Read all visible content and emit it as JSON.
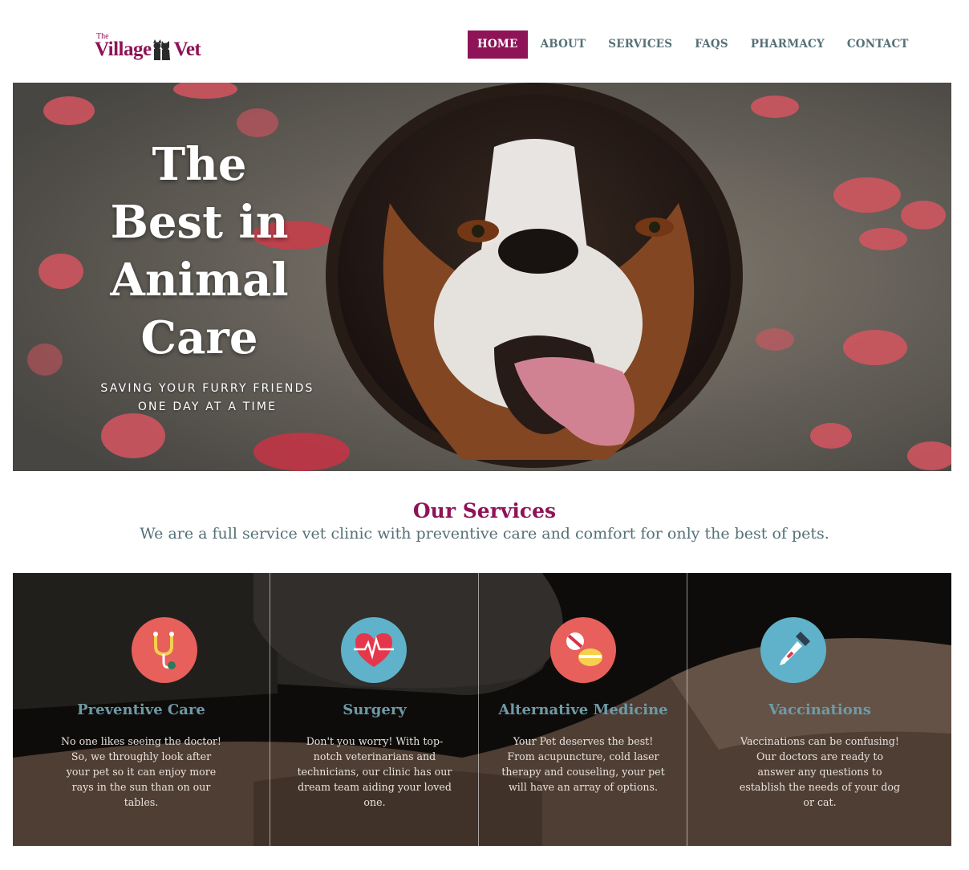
{
  "logo": {
    "the": "The",
    "village": "Village",
    "vet": "Vet",
    "icon": "dog-and-cat-icon"
  },
  "nav": {
    "items": [
      {
        "label": "HOME",
        "active": true
      },
      {
        "label": "ABOUT",
        "active": false
      },
      {
        "label": "SERVICES",
        "active": false
      },
      {
        "label": "FAQS",
        "active": false
      },
      {
        "label": "PHARMACY",
        "active": false
      },
      {
        "label": "CONTACT",
        "active": false
      }
    ]
  },
  "hero": {
    "title_lines": [
      "The",
      "Best in",
      "Animal",
      "Care"
    ],
    "subtitle_lines": [
      "SAVING YOUR FURRY FRIENDS",
      "ONE DAY AT A TIME"
    ]
  },
  "services": {
    "heading": "Our Services",
    "description": "We are a full service vet clinic with preventive care and comfort for only the best of pets.",
    "items": [
      {
        "title": "Preventive Care",
        "icon": "stethoscope-icon",
        "color": "#e8605b",
        "text": "No one likes seeing the doctor! So, we throughly look after your pet so it can enjoy more rays in the sun than on our tables."
      },
      {
        "title": "Surgery",
        "icon": "heartbeat-icon",
        "color": "#5fb2c9",
        "text": "Don't you worry! With top-notch veterinarians and technicians, our clinic has our dream team aiding your loved one."
      },
      {
        "title": "Alternative Medicine",
        "icon": "pills-icon",
        "color": "#e8605b",
        "text": "Your Pet deserves the best! From acupuncture, cold laser therapy and couseling, your pet will have an array of options."
      },
      {
        "title": "Vaccinations",
        "icon": "dropper-icon",
        "color": "#5fb2c9",
        "text": "Vaccinations can be confusing! Our doctors are ready to answer any questions to establish the needs of your dog or cat."
      }
    ]
  },
  "colors": {
    "brand": "#8e1357",
    "nav_text": "#557077",
    "service_title": "#6e9aa6",
    "coral": "#e8605b",
    "teal": "#5fb2c9"
  }
}
